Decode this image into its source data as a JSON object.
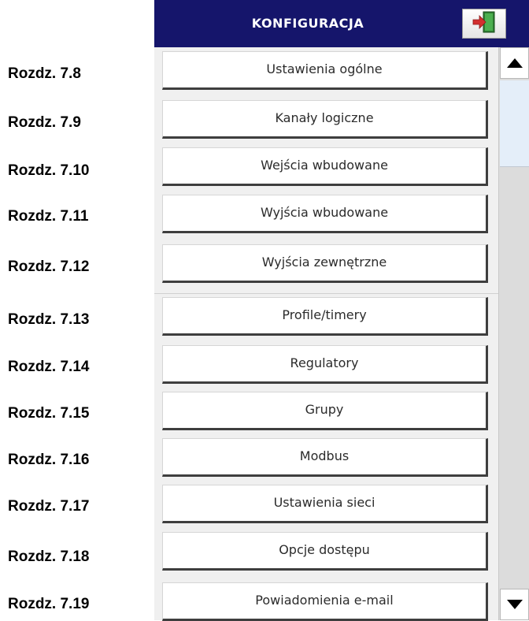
{
  "header": {
    "title": "KONFIGURACJA",
    "exit_icon": "exit-door-icon"
  },
  "menu": {
    "items": [
      {
        "label": "Ustawienia ogólne",
        "chapter": "Rozdz. 7.8"
      },
      {
        "label": "Kanały logiczne",
        "chapter": "Rozdz. 7.9"
      },
      {
        "label": "Wejścia wbudowane",
        "chapter": "Rozdz. 7.10"
      },
      {
        "label": "Wyjścia wbudowane",
        "chapter": "Rozdz. 7.11"
      },
      {
        "label": "Wyjścia zewnętrzne",
        "chapter": "Rozdz. 7.12"
      },
      {
        "label": "Profile/timery",
        "chapter": "Rozdz. 7.13"
      },
      {
        "label": "Regulatory",
        "chapter": "Rozdz. 7.14"
      },
      {
        "label": "Grupy",
        "chapter": "Rozdz. 7.15"
      },
      {
        "label": "Modbus",
        "chapter": "Rozdz. 7.16"
      },
      {
        "label": "Ustawienia sieci",
        "chapter": "Rozdz. 7.17"
      },
      {
        "label": "Opcje dostępu",
        "chapter": "Rozdz. 7.18"
      },
      {
        "label": "Powiadomienia e-mail",
        "chapter": "Rozdz. 7.19"
      }
    ]
  },
  "scrollbar": {
    "up_icon": "arrow-up-icon",
    "down_icon": "arrow-down-icon"
  },
  "colors": {
    "title_bar": "#15156b",
    "screen_bg": "#f0f0f0",
    "button_bg": "#ffffff",
    "button_shadow": "#3e3e3e",
    "scroll_thumb": "#e4eef9"
  }
}
